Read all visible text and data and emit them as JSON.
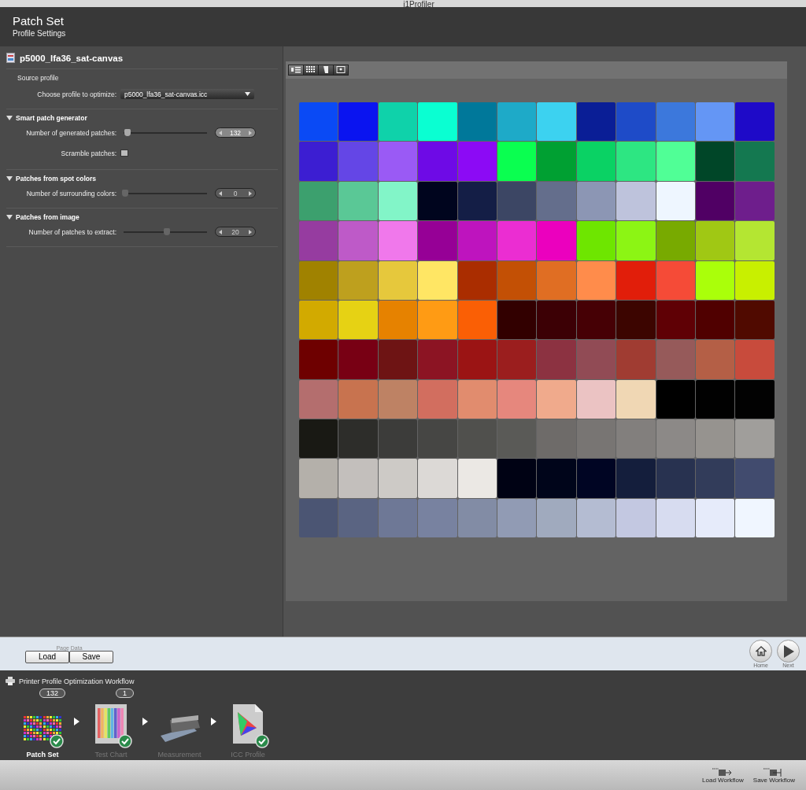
{
  "window": {
    "title": "i1Profiler"
  },
  "header": {
    "title": "Patch Set",
    "subtitle": "Profile Settings"
  },
  "document": {
    "name": "p5000_lfa36_sat-canvas"
  },
  "source": {
    "heading": "Source profile",
    "label": "Choose profile to optimize:",
    "value": "p5000_lfa36_sat-canvas.icc"
  },
  "sections": [
    {
      "title": "Smart patch generator",
      "expanded": true,
      "rows": [
        {
          "kind": "slider",
          "label": "Number of generated patches:",
          "level": 0.03,
          "value": "132",
          "disabled": false
        },
        {
          "kind": "checkbox",
          "label": "Scramble patches:",
          "checked": false
        }
      ]
    },
    {
      "title": "Patches from spot colors",
      "expanded": true,
      "rows": [
        {
          "kind": "slider",
          "label": "Number of surrounding colors:",
          "level": 0,
          "value": "0",
          "disabled": true
        }
      ]
    },
    {
      "title": "Patches from image",
      "expanded": true,
      "rows": [
        {
          "kind": "slider",
          "label": "Number of patches to extract:",
          "level": 0.5,
          "value": "20",
          "disabled": true
        }
      ]
    }
  ],
  "view_tabs": [
    {
      "kind": "list",
      "selected": true
    },
    {
      "kind": "grid",
      "selected": false
    },
    {
      "kind": "tone",
      "selected": false
    },
    {
      "kind": "image",
      "selected": false
    }
  ],
  "patch_rows": [
    [
      {
        "color": "#0a4af5"
      },
      {
        "color": "#0a14f0"
      },
      {
        "color": "#0fd2aa"
      },
      {
        "color": "#0affd2"
      },
      {
        "color": "#00789a"
      },
      {
        "color": "#1eaac8"
      },
      {
        "color": "#3cd2f0"
      },
      {
        "color": "#0a1e96"
      },
      {
        "color": "#1e4bc8"
      },
      {
        "color": "#3c78dc"
      },
      {
        "color": "#6496f5"
      },
      {
        "color": "#1e0ac8"
      }
    ],
    [
      {
        "color": "#3c1ed2"
      },
      {
        "color": "#6446e6"
      },
      {
        "color": "#9a5af5"
      },
      {
        "color": "#6e0ae6"
      },
      {
        "color": "#8c0af5"
      },
      {
        "color": "#0aff50"
      },
      {
        "color": "#00a032"
      },
      {
        "color": "#0ad264"
      },
      {
        "color": "#2de682"
      },
      {
        "color": "#50ff96"
      },
      {
        "color": "#004628"
      },
      {
        "color": "#147850"
      }
    ],
    [
      {
        "color": "#3ca06e"
      },
      {
        "color": "#5ac896"
      },
      {
        "color": "#82f5c8"
      },
      {
        "color": "#00051e"
      },
      {
        "color": "#141e46"
      },
      {
        "color": "#3c4664"
      },
      {
        "color": "#646e8c"
      },
      {
        "color": "#8c96b4"
      },
      {
        "color": "#bec3dc"
      },
      {
        "color": "#eef6ff"
      },
      {
        "color": "#500064"
      },
      {
        "color": "#6e1e8c"
      }
    ],
    [
      {
        "color": "#963ca0"
      },
      {
        "color": "#be5ac8"
      },
      {
        "color": "#f078eb"
      },
      {
        "color": "#960096"
      },
      {
        "color": "#be14be"
      },
      {
        "color": "#eb2dd2"
      },
      {
        "color": "#eb00be"
      },
      {
        "color": "#6ee600"
      },
      {
        "color": "#8cf514"
      },
      {
        "color": "#78aa00"
      },
      {
        "color": "#a0c814"
      },
      {
        "color": "#b4e632"
      }
    ],
    [
      {
        "color": "#a08200"
      },
      {
        "color": "#bea01e"
      },
      {
        "color": "#e6c83c"
      },
      {
        "color": "#ffe664"
      },
      {
        "color": "#aa2d00"
      },
      {
        "color": "#c35005"
      },
      {
        "color": "#e06e23"
      },
      {
        "color": "#ff8c4b"
      },
      {
        "color": "#e11e0a"
      },
      {
        "color": "#f54b37"
      },
      {
        "color": "#aaff0a"
      },
      {
        "color": "#c8f000"
      }
    ],
    [
      {
        "color": "#d2aa00"
      },
      {
        "color": "#e6d214"
      },
      {
        "color": "#e68200"
      },
      {
        "color": "#ff9b14"
      },
      {
        "color": "#fa5f05"
      },
      {
        "color": "#320000"
      },
      {
        "color": "#3c0005"
      },
      {
        "color": "#460005"
      },
      {
        "color": "#3c0500"
      },
      {
        "color": "#5f0005"
      },
      {
        "color": "#500000"
      },
      {
        "color": "#500a00"
      }
    ],
    [
      {
        "color": "#6e0000"
      },
      {
        "color": "#780014"
      },
      {
        "color": "#6e1414"
      },
      {
        "color": "#8c1423"
      },
      {
        "color": "#9b1414"
      },
      {
        "color": "#9b1e1e"
      },
      {
        "color": "#8c3241"
      },
      {
        "color": "#914b55"
      },
      {
        "color": "#a03c32"
      },
      {
        "color": "#965a5a"
      },
      {
        "color": "#b45f46"
      },
      {
        "color": "#c84b3c"
      }
    ],
    [
      {
        "color": "#b46e6e"
      },
      {
        "color": "#c8734f"
      },
      {
        "color": "#be8264"
      },
      {
        "color": "#d26e5f"
      },
      {
        "color": "#e18c6e"
      },
      {
        "color": "#e6877d"
      },
      {
        "color": "#f0aa8c"
      },
      {
        "color": "#ebc3c3"
      },
      {
        "color": "#f0d7b4"
      },
      {
        "color": "#000000"
      },
      {
        "color": "#010101"
      },
      {
        "color": "#020202"
      }
    ],
    [
      {
        "color": "#191914"
      },
      {
        "color": "#2d2d2a"
      },
      {
        "color": "#3c3c3a"
      },
      {
        "color": "#464644"
      },
      {
        "color": "#50504d"
      },
      {
        "color": "#5a5a57"
      },
      {
        "color": "#6e6b69"
      },
      {
        "color": "#787573"
      },
      {
        "color": "#827f7d"
      },
      {
        "color": "#8c8987"
      },
      {
        "color": "#96938f"
      },
      {
        "color": "#a09e9b"
      }
    ],
    [
      {
        "color": "#b4b0aa"
      },
      {
        "color": "#c3bfbc"
      },
      {
        "color": "#cdcac6"
      },
      {
        "color": "#dcd9d6"
      },
      {
        "color": "#ebe8e4"
      },
      {
        "color": "#000214"
      },
      {
        "color": "#00051a"
      },
      {
        "color": "#000523"
      },
      {
        "color": "#141e3c"
      },
      {
        "color": "#283250"
      },
      {
        "color": "#323c5a"
      },
      {
        "color": "#414b6e"
      }
    ],
    [
      {
        "color": "#4b5573"
      },
      {
        "color": "#5a6482"
      },
      {
        "color": "#6e7896"
      },
      {
        "color": "#7882a0"
      },
      {
        "color": "#828ca5"
      },
      {
        "color": "#919bb4"
      },
      {
        "color": "#a0aabe"
      },
      {
        "color": "#b4bcd2"
      },
      {
        "color": "#c3c8e1"
      },
      {
        "color": "#d7dcf0"
      },
      {
        "color": "#e6ebfa"
      },
      {
        "color": "#f0f6ff"
      }
    ]
  ],
  "page_data": {
    "caption": "Page Data",
    "buttons": [
      "Load",
      "Save"
    ]
  },
  "nav_buttons": [
    {
      "kind": "home",
      "label": "Home"
    },
    {
      "kind": "next",
      "label": "Next"
    }
  ],
  "workflow": {
    "title": "Printer Profile Optimization Workflow",
    "steps": [
      {
        "kind": "patches",
        "label": "Patch Set",
        "badge": "132",
        "done": true,
        "selected": true
      },
      {
        "kind": "chart",
        "label": "Test Chart",
        "badge": "1",
        "done": true,
        "selected": false
      },
      {
        "kind": "printer",
        "label": "Measurement",
        "done": false,
        "selected": false
      },
      {
        "kind": "profile",
        "label": "ICC Profile",
        "done": true,
        "selected": false
      }
    ]
  },
  "footer_buttons": [
    {
      "kind": "load",
      "label": "Load Workflow"
    },
    {
      "kind": "save",
      "label": "Save Workflow"
    }
  ]
}
